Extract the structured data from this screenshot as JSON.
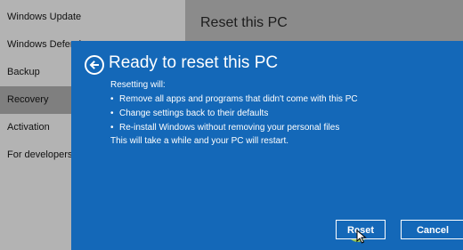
{
  "sidebar": {
    "items": [
      {
        "label": "Windows Update",
        "selected": false
      },
      {
        "label": "Windows Defender",
        "selected": false
      },
      {
        "label": "Backup",
        "selected": false
      },
      {
        "label": "Recovery",
        "selected": true
      },
      {
        "label": "Activation",
        "selected": false
      },
      {
        "label": "For developers",
        "selected": false
      }
    ]
  },
  "content": {
    "title": "Reset this PC"
  },
  "dialog": {
    "title": "Ready to reset this PC",
    "intro": "Resetting will:",
    "bullets": [
      "Remove all apps and programs that didn't come with this PC",
      "Change settings back to their defaults",
      "Re-install Windows without removing your personal files"
    ],
    "note": "This will take a while and your PC will restart.",
    "reset_label": "Reset",
    "cancel_label": "Cancel"
  },
  "icons": {
    "back": "back-arrow-icon",
    "cursor": "mouse-pointer-icon"
  },
  "colors": {
    "dialog_bg": "#1468b8",
    "highlight": "#c6e83a"
  }
}
